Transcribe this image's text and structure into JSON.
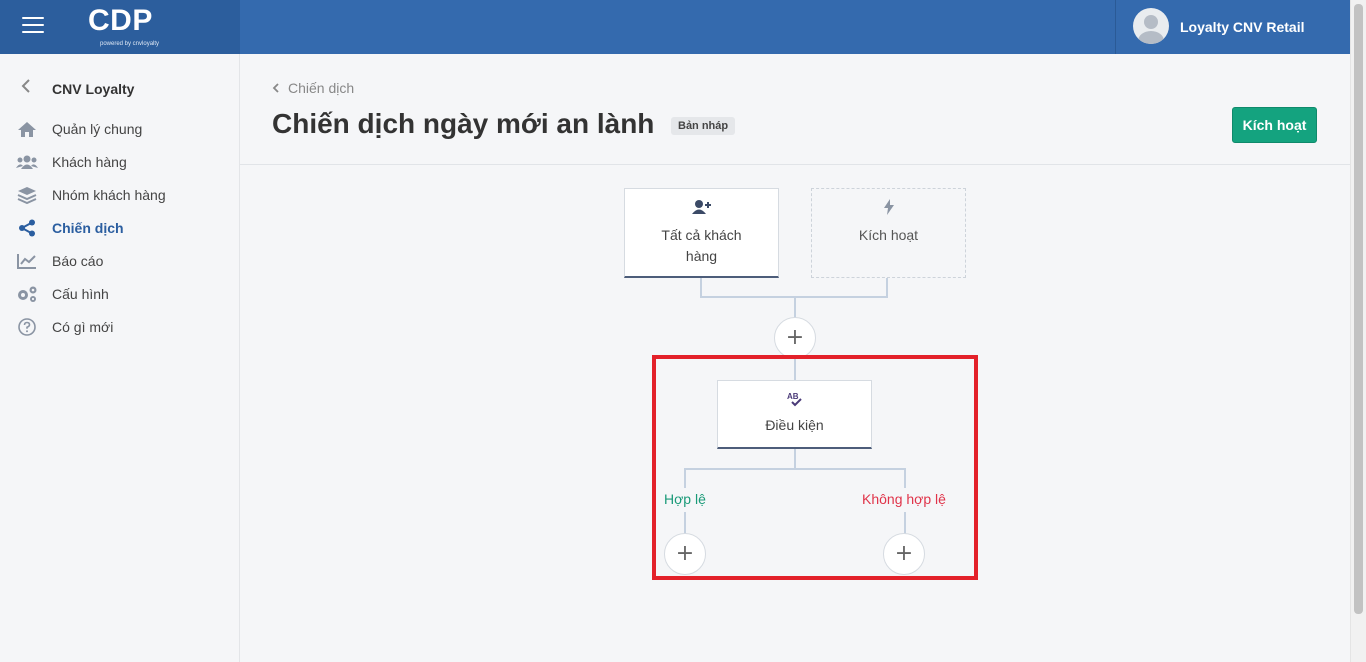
{
  "header": {
    "logo_text": "CDP",
    "logo_sub": "powered by cnvloyalty",
    "user_name": "Loyalty CNV Retail"
  },
  "sidebar": {
    "title": "CNV Loyalty",
    "items": [
      {
        "label": "Quản lý chung",
        "icon": "home-icon",
        "active": false
      },
      {
        "label": "Khách hàng",
        "icon": "users-icon",
        "active": false
      },
      {
        "label": "Nhóm khách hàng",
        "icon": "layers-icon",
        "active": false
      },
      {
        "label": "Chiến dịch",
        "icon": "share-icon",
        "active": true
      },
      {
        "label": "Báo cáo",
        "icon": "chart-icon",
        "active": false
      },
      {
        "label": "Cấu hình",
        "icon": "gears-icon",
        "active": false
      },
      {
        "label": "Có gì mới",
        "icon": "question-icon",
        "active": false
      }
    ]
  },
  "page": {
    "breadcrumb": "Chiến dịch",
    "title": "Chiến dịch ngày mới an lành",
    "status_badge": "Bản nháp",
    "activate_button": "Kích hoạt"
  },
  "flow": {
    "audience_node": "Tất cả khách hàng",
    "trigger_node": "Kích hoạt",
    "condition_node": "Điều kiện",
    "branch_valid": "Hợp lệ",
    "branch_invalid": "Không hợp lệ",
    "add_symbol": "+"
  },
  "colors": {
    "topbar": "#346aae",
    "accent_green": "#14a37f",
    "active_menu": "#2b5ea0",
    "valid": "#1a9a78",
    "invalid": "#e0344a",
    "highlight": "#e3212a"
  }
}
